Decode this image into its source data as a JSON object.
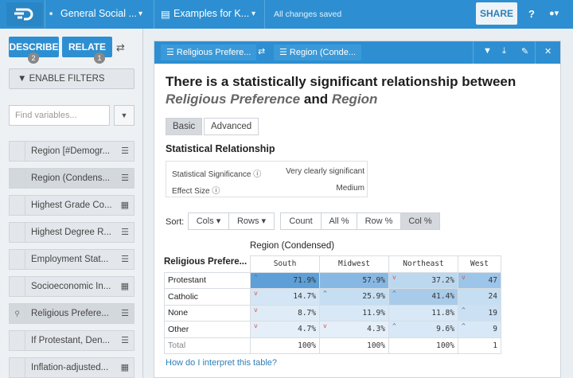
{
  "topbar": {
    "project": "General Social ...",
    "project_caret": "▾",
    "dataset": "Examples for K...",
    "dataset_caret": "▾",
    "status": "All changes saved",
    "share_label": "SHARE",
    "help_icon": "?",
    "user_icon": "▾"
  },
  "sidebar": {
    "describe_label": "DESCRIBE",
    "describe_badge": "2",
    "relate_label": "RELATE",
    "relate_badge": "1",
    "filters_label": "ENABLE FILTERS",
    "search_placeholder": "Find variables...",
    "variables": [
      {
        "label": "Region [#Demogr...",
        "icon": "list-icon"
      },
      {
        "label": "Region (Condens...",
        "icon": "list-icon"
      },
      {
        "label": "Highest Grade Co...",
        "icon": "chart-icon"
      },
      {
        "label": "Highest Degree R...",
        "icon": "list-icon"
      },
      {
        "label": "Employment Stat...",
        "icon": "list-icon"
      },
      {
        "label": "Socioeconomic In...",
        "icon": "chart-icon"
      },
      {
        "label": "Religious Prefere...",
        "icon": "list-icon"
      },
      {
        "label": "If Protestant, Den...",
        "icon": "list-icon"
      },
      {
        "label": "Inflation-adjusted...",
        "icon": "chart-icon"
      }
    ]
  },
  "panel": {
    "var1": "Religious Prefere...",
    "var2": "Region (Conde...",
    "headline_pre": "There is a statistically significant relationship between",
    "headline_var1": "Religious Preference",
    "headline_and": "and",
    "headline_var2": "Region",
    "tab_basic": "Basic",
    "tab_advanced": "Advanced",
    "section_title": "Statistical Relationship",
    "sig_label": "Statistical Significance",
    "sig_value": "Very clearly significant",
    "effect_label": "Effect Size",
    "effect_value": "Medium",
    "sort_label": "Sort:",
    "sort_cols": "Cols ▾",
    "sort_rows": "Rows ▾",
    "view_count": "Count",
    "view_all": "All %",
    "view_row": "Row %",
    "view_col": "Col %",
    "col_var_title": "Region (Condensed)",
    "row_var_title": "Religious Prefere...",
    "columns": [
      "South",
      "Midwest",
      "Northeast",
      "West"
    ],
    "rows": [
      {
        "label": "Protestant",
        "cells": [
          {
            "v": "71.9%",
            "m": "^",
            "bg": "#5d9fd6"
          },
          {
            "v": "57.9%",
            "m": "",
            "bg": "#87b8e3"
          },
          {
            "v": "37.2%",
            "m": "v",
            "bg": "#bcd8ef"
          },
          {
            "v": "47",
            "m": "v",
            "bg": "#9cc5e9"
          }
        ]
      },
      {
        "label": "Catholic",
        "cells": [
          {
            "v": "14.7%",
            "m": "v",
            "bg": "#d4e6f5"
          },
          {
            "v": "25.9%",
            "m": "^",
            "bg": "#c5def2"
          },
          {
            "v": "41.4%",
            "m": "^",
            "bg": "#a9cbea"
          },
          {
            "v": "24",
            "m": "",
            "bg": "#c5def2"
          }
        ]
      },
      {
        "label": "None",
        "cells": [
          {
            "v": "8.7%",
            "m": "v",
            "bg": "#dfecf7"
          },
          {
            "v": "11.9%",
            "m": "",
            "bg": "#d8e8f6"
          },
          {
            "v": "11.8%",
            "m": "",
            "bg": "#d8e8f6"
          },
          {
            "v": "19",
            "m": "^",
            "bg": "#cbe0f3"
          }
        ]
      },
      {
        "label": "Other",
        "cells": [
          {
            "v": "4.7%",
            "m": "v",
            "bg": "#e4eff9"
          },
          {
            "v": "4.3%",
            "m": "v",
            "bg": "#e4eff9"
          },
          {
            "v": "9.6%",
            "m": "^",
            "bg": "#d8e8f6"
          },
          {
            "v": "9",
            "m": "^",
            "bg": "#d8e8f6"
          }
        ]
      }
    ],
    "total_label": "Total",
    "totals": [
      "100%",
      "100%",
      "100%",
      "1"
    ],
    "interpret_link": "How do I interpret this table?"
  },
  "colors": {
    "accent": "#2d8fd1",
    "up_marker": "#2b6cb0",
    "down_marker": "#d9534f"
  }
}
